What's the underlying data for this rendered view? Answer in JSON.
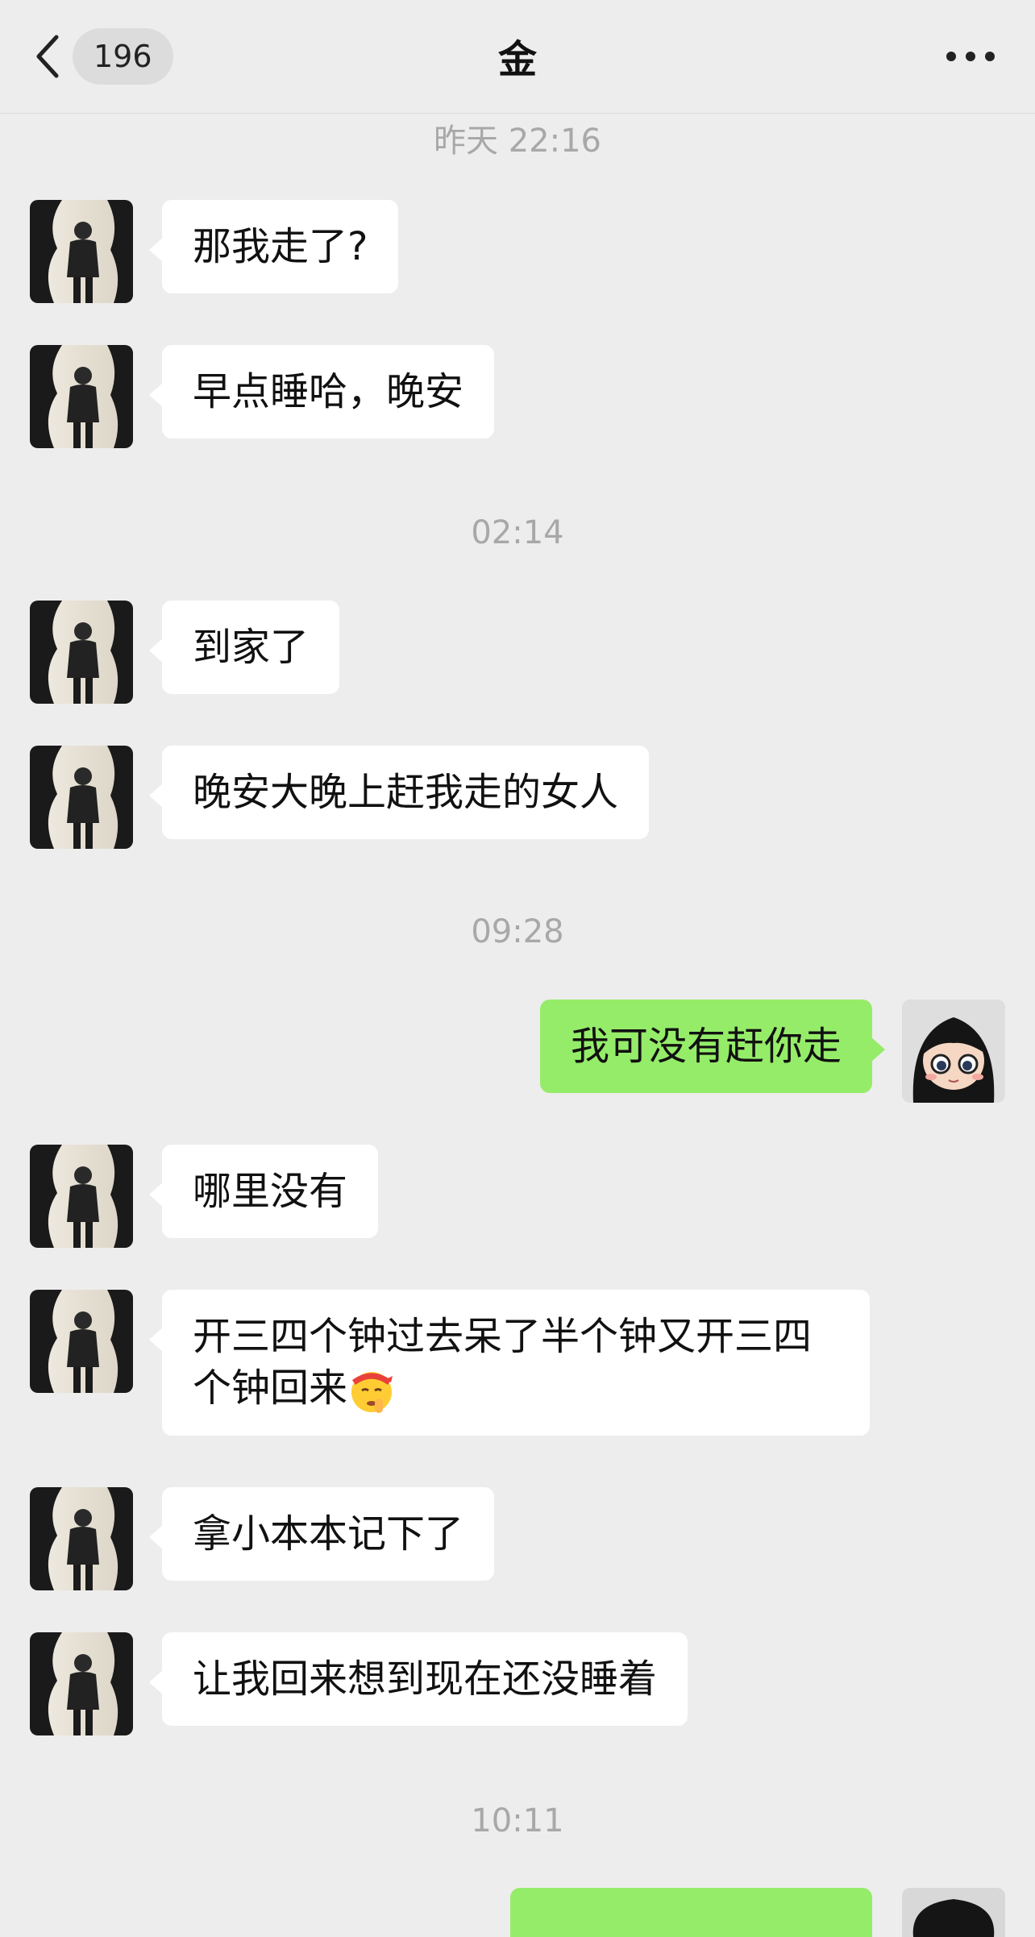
{
  "navbar": {
    "unread_count": "196",
    "title": "金"
  },
  "timestamps": [
    "昨天 22:16",
    "02:14",
    "09:28",
    "10:11"
  ],
  "messages": [
    {
      "sender": "contact",
      "text": "那我走了?"
    },
    {
      "sender": "contact",
      "text": "早点睡哈，晚安"
    },
    {
      "sender": "contact",
      "text": "到家了"
    },
    {
      "sender": "contact",
      "text": "晚安大晚上赶我走的女人"
    },
    {
      "sender": "me",
      "text": "我可没有赶你走"
    },
    {
      "sender": "contact",
      "text": "哪里没有"
    },
    {
      "sender": "contact",
      "text": "开三四个钟过去呆了半个钟又开三四个钟回来",
      "emoji": "shushing-face-emoji"
    },
    {
      "sender": "contact",
      "text": "拿小本本记下了"
    },
    {
      "sender": "contact",
      "text": "让我回来想到现在还没睡着"
    }
  ],
  "icons": {
    "back": "chevron-left-icon",
    "more": "more-dots-icon"
  },
  "colors": {
    "background": "#ededed",
    "incoming_bubble": "#ffffff",
    "outgoing_bubble": "#95ec69",
    "timestamp": "#a8a8a8"
  }
}
